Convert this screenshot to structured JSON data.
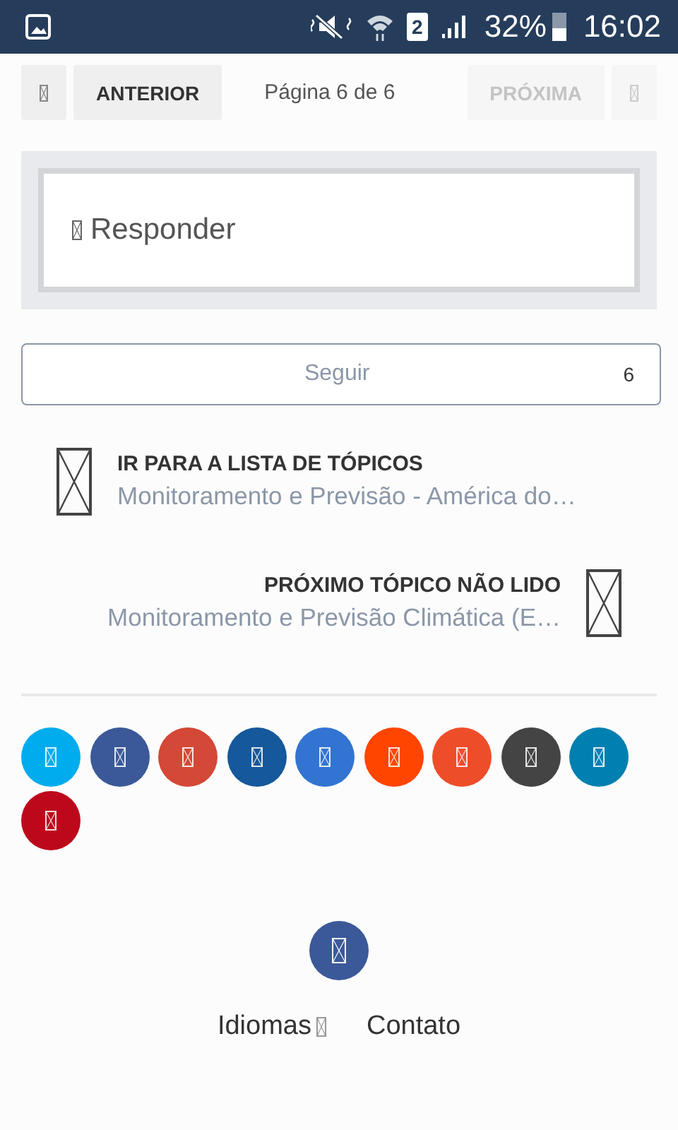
{
  "status_bar": {
    "sim_slot": "2",
    "battery_percent": "32%",
    "time": "16:02"
  },
  "pager": {
    "previous": {
      "label": "ANTERIOR",
      "disabled": false
    },
    "page_info": "Página 6 de 6",
    "next": {
      "label": "PRÓXIMA",
      "disabled": true
    }
  },
  "reply": {
    "label": "Responder"
  },
  "follow": {
    "label": "Seguir",
    "count": "6"
  },
  "suggested": [
    {
      "kind": "back",
      "heading": "IR PARA A LISTA DE TÓPICOS",
      "title": "Monitoramento e Previsão - América do…"
    },
    {
      "kind": "forward",
      "heading": "PRÓXIMO TÓPICO NÃO LIDO",
      "title": "Monitoramento e Previsão Climática (E…"
    }
  ],
  "share_buttons": [
    {
      "color": "#00aced"
    },
    {
      "color": "#3b5998"
    },
    {
      "color": "#d34836"
    },
    {
      "color": "#15589b"
    },
    {
      "color": "#3274d1"
    },
    {
      "color": "#ff4500"
    },
    {
      "color": "#ee4d2a"
    },
    {
      "color": "#444444"
    },
    {
      "color": "#0080b0"
    },
    {
      "color": "#bd081c"
    }
  ],
  "footer": {
    "links": [
      {
        "label": "Idiomas",
        "has_icon": true
      },
      {
        "label": "Contato",
        "has_icon": false
      }
    ]
  }
}
